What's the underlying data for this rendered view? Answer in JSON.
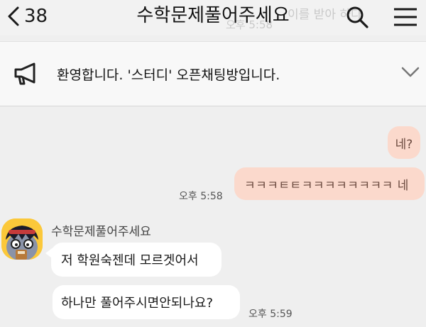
{
  "header": {
    "back_count": "38",
    "chat_title": "수학문제풀어주세요",
    "ghost_text_1": "이를 받아 하다",
    "ghost_text_2": "오후 5:58",
    "icons": [
      "chevron-left-icon",
      "search-icon",
      "menu-icon"
    ]
  },
  "notice": {
    "icon": "megaphone-icon",
    "text": "환영합니다. '스터디' 오픈채팅방입니다.",
    "expand_icon": "chevron-down-icon"
  },
  "messages": [
    {
      "from": "me",
      "text": "네?"
    },
    {
      "from": "me",
      "text": "ㅋㅋㅋㅌㅌㅋㅋㅋㅋㅋㅋㅋㅋ 네",
      "time": "오후 5:58"
    },
    {
      "from": "other",
      "sender": "수학문제풀어주세요",
      "text": "저 학원숙젠데 모르겟어서"
    },
    {
      "from": "other",
      "text": "하나만 풀어주시면안되나요?",
      "time": "오후 5:59"
    }
  ],
  "colors": {
    "background": "#efefef",
    "my_bubble": "#fbd9cc",
    "other_bubble": "#ffffff",
    "avatar_bg": "#fbc83a"
  }
}
